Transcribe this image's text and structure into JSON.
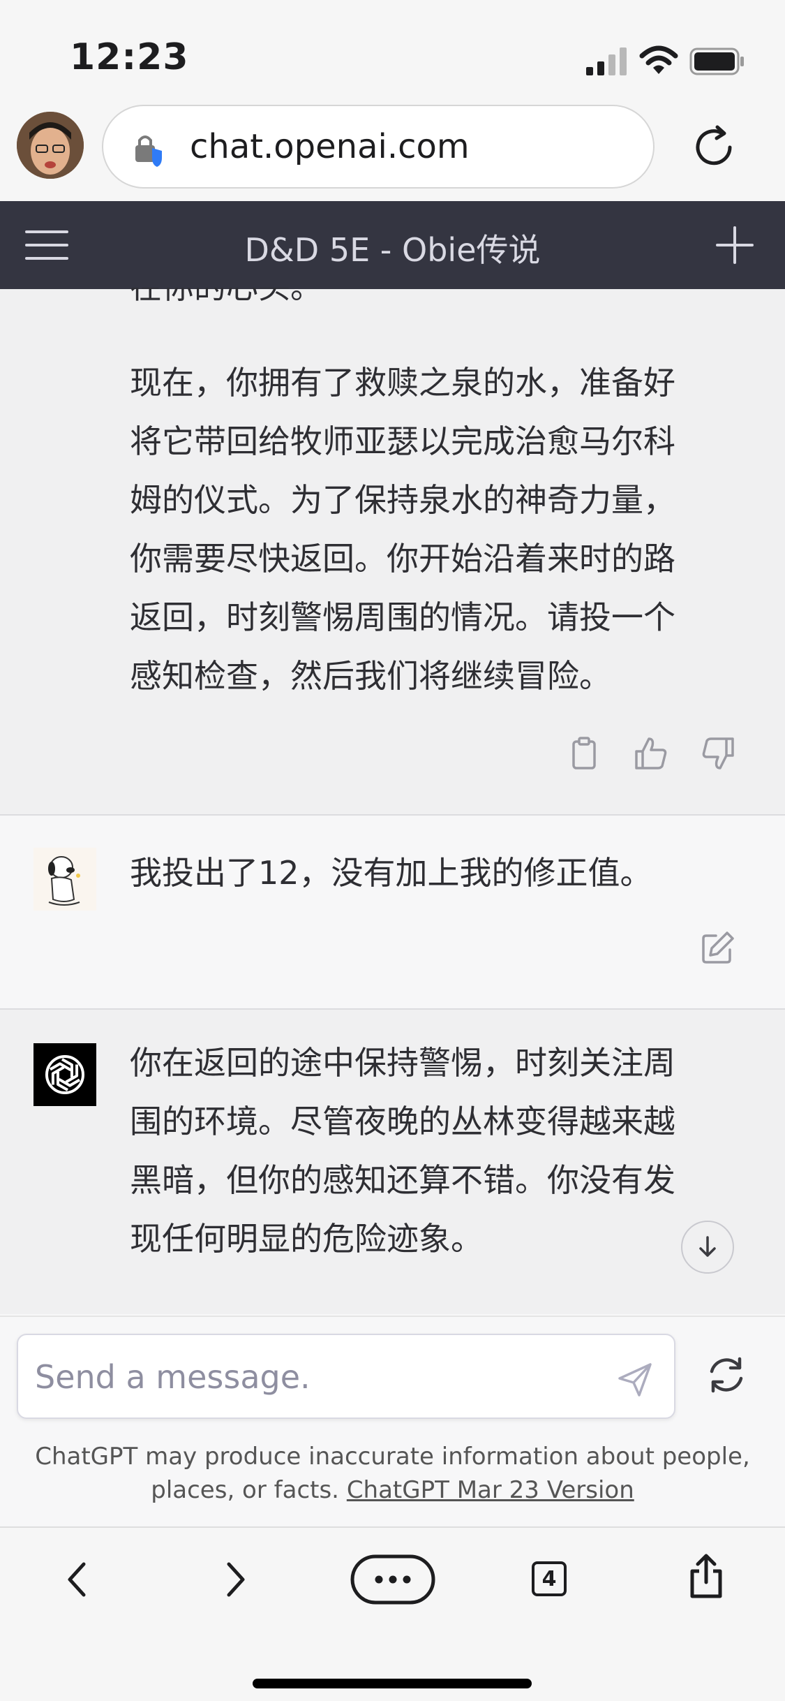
{
  "status_bar": {
    "time": "12:23"
  },
  "browser": {
    "url": "chat.openai.com"
  },
  "chat": {
    "title": "D&D 5E - Obie传说"
  },
  "messages": [
    {
      "role": "assistant",
      "clipped_text": "在你的心头。",
      "lines": [
        "现在，你拥有了救赎之泉的水，准备好",
        "将它带回给牧师亚瑟以完成治愈马尔科",
        "姆的仪式。为了保持泉水的神奇力量，",
        "你需要尽快返回。你开始沿着来时的路",
        "返回，时刻警惕周围的情况。请投一个",
        "感知检查，然后我们将继续冒险。"
      ]
    },
    {
      "role": "user",
      "lines": [
        "我投出了12，没有加上我的修正值。"
      ]
    },
    {
      "role": "assistant",
      "lines": [
        "你在返回的途中保持警惕，时刻关注周",
        "围的环境。尽管夜晚的丛林变得越来越",
        "黑暗，但你的感知还算不错。你没有发",
        "现任何明显的危险迹象。"
      ]
    }
  ],
  "composer": {
    "placeholder": "Send a message.",
    "disclaimer_line1": "ChatGPT may produce inaccurate information about people,",
    "disclaimer_line2": "places, or facts.",
    "version_link": "ChatGPT Mar 23 Version"
  },
  "toolbar": {
    "tab_count": "4"
  },
  "icons": {
    "status": [
      "signal-icon",
      "wifi-icon",
      "battery-icon"
    ],
    "header": [
      "menu-icon",
      "plus-icon"
    ],
    "message_actions": [
      "copy-icon",
      "thumbs-up-icon",
      "thumbs-down-icon",
      "edit-icon"
    ],
    "composer": [
      "send-icon",
      "regenerate-icon",
      "scroll-down-icon"
    ],
    "toolbar": [
      "back-icon",
      "forward-icon",
      "more-icon",
      "tabs-icon",
      "share-icon"
    ]
  },
  "colors": {
    "header_bg": "#343541",
    "assistant_bg": "#f0f0f1",
    "user_bg": "#f7f7f8",
    "text": "#2e2e33"
  }
}
